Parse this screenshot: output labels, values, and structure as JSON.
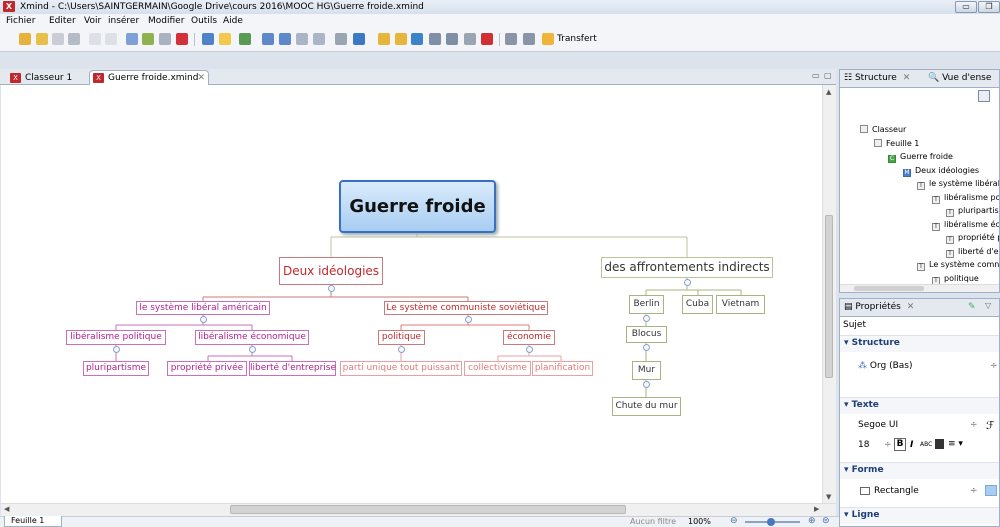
{
  "window": {
    "title": "Xmind - C:\\Users\\SAINTGERMAIN\\Google Drive\\cours 2016\\MOOC HG\\Guerre froide.xmind",
    "icon": "X"
  },
  "menu": [
    "Fichier",
    "Editer",
    "Voir",
    "insérer",
    "Modifier",
    "Outils",
    "Aide"
  ],
  "toolbar": {
    "transfer_label": "Transfert"
  },
  "tabs": [
    {
      "label": "Classeur 1"
    },
    {
      "label": "Guerre froide.xmind"
    }
  ],
  "mindmap": {
    "central": "Guerre froide",
    "branch_left": "Deux idéologies",
    "branch_right": "des affrontements indirects",
    "liberal": "le système libéral américain",
    "communist": "Le système communiste soviétique",
    "lib_pol": "libéralisme politique",
    "lib_eco": "libéralisme économique",
    "pluri": "pluripartisme",
    "propriete": "propriété privée",
    "liberte": "liberté d'entreprise",
    "politique": "politique",
    "economie": "économie",
    "parti": "parti unique tout puissant",
    "collectivisme": "collectivisme",
    "planification": "planification",
    "berlin": "Berlin",
    "cuba": "Cuba",
    "vietnam": "Vietnam",
    "blocus": "Blocus",
    "mur": "Mur",
    "chute": "Chute du mur"
  },
  "structure_panel": {
    "tab1": "Structure",
    "tab2": "Vue d'ense",
    "tree": [
      {
        "label": "Classeur",
        "icon": "workbook"
      },
      {
        "label": "Feuille 1",
        "icon": "sheet"
      },
      {
        "label": "Guerre froide",
        "icon": "C"
      },
      {
        "label": "Deux idéologies",
        "icon": "M"
      },
      {
        "label": "le système libéral",
        "icon": "T"
      },
      {
        "label": "libéralisme po",
        "icon": "T"
      },
      {
        "label": "pluripartis",
        "icon": "T"
      },
      {
        "label": "libéralisme éc",
        "icon": "T"
      },
      {
        "label": "propriété p",
        "icon": "T"
      },
      {
        "label": "liberté d'e",
        "icon": "T"
      },
      {
        "label": "Le système comn",
        "icon": "T"
      },
      {
        "label": "politique",
        "icon": "T"
      }
    ]
  },
  "properties_panel": {
    "title": "Propriétés",
    "subject": "Sujet",
    "section_structure": "Structure",
    "structure_value": "Org (Bas)",
    "section_text": "Texte",
    "font_name": "Segoe UI",
    "font_size": "18",
    "section_shape": "Forme",
    "shape_value": "Rectangle",
    "section_line": "Ligne"
  },
  "status": {
    "sheet_tab": "Feuille 1",
    "filter": "Aucun filtre",
    "zoom": "100%"
  },
  "colors": {
    "accent_blue": "#3a70c4",
    "topic_red": "#c0282c",
    "topic_magenta": "#b3208f",
    "topic_salmon": "#e27a78"
  }
}
